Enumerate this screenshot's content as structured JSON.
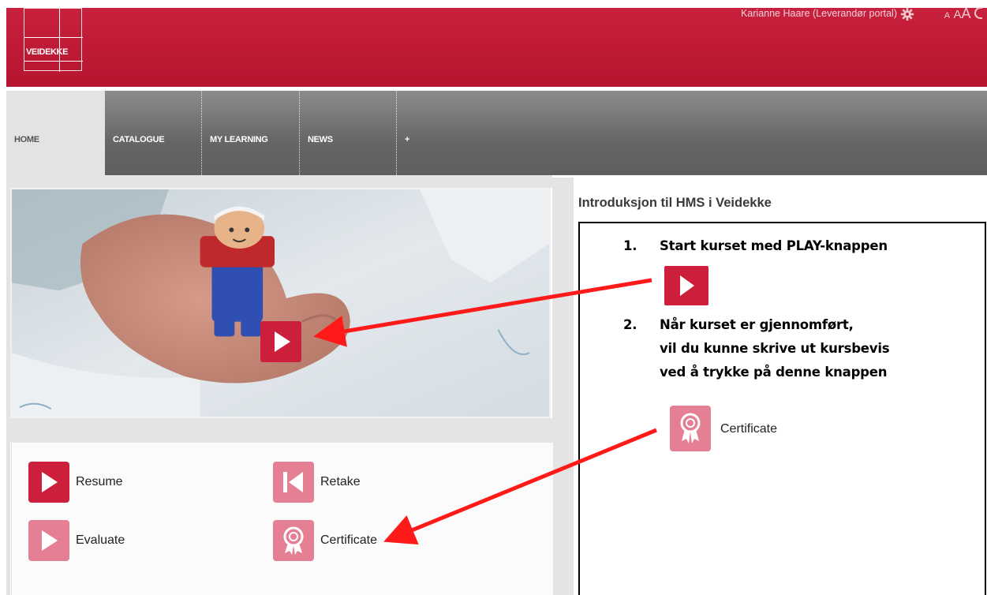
{
  "header": {
    "logo_text": "VEIDEKKE",
    "user_label": "Karianne Haare  (Leverandør portal)",
    "font_sizes": [
      "A",
      "A",
      "A"
    ],
    "brand_color": "#c8213d"
  },
  "nav": {
    "tabs": [
      {
        "label": "HOME"
      },
      {
        "label": "CATALOGUE"
      },
      {
        "label": "MY LEARNING"
      },
      {
        "label": "NEWS"
      },
      {
        "label": "+"
      }
    ]
  },
  "actions": {
    "resume": "Resume",
    "retake": "Retake",
    "evaluate": "Evaluate",
    "certificate": "Certificate"
  },
  "course": {
    "title": "Introduksjon til HMS i Veidekke"
  },
  "instructions": {
    "step1_number": "1.",
    "step1_text": "Start kurset med PLAY-knappen",
    "step2_number": "2.",
    "step2_line1": "Når kurset er gjennomført,",
    "step2_line2": "vil du kunne skrive ut kursbevis",
    "step2_line3": "ved å trykke på denne knappen",
    "certificate_label": "Certificate"
  },
  "icons": {
    "play": "play-icon",
    "retake": "skip-back-icon",
    "certificate": "award-ribbon-icon",
    "settings": "gear-icon"
  },
  "colors": {
    "accent_dark": "#cc1f3c",
    "accent_light": "#e57f93",
    "annotation_arrow": "#ff1a1a"
  }
}
